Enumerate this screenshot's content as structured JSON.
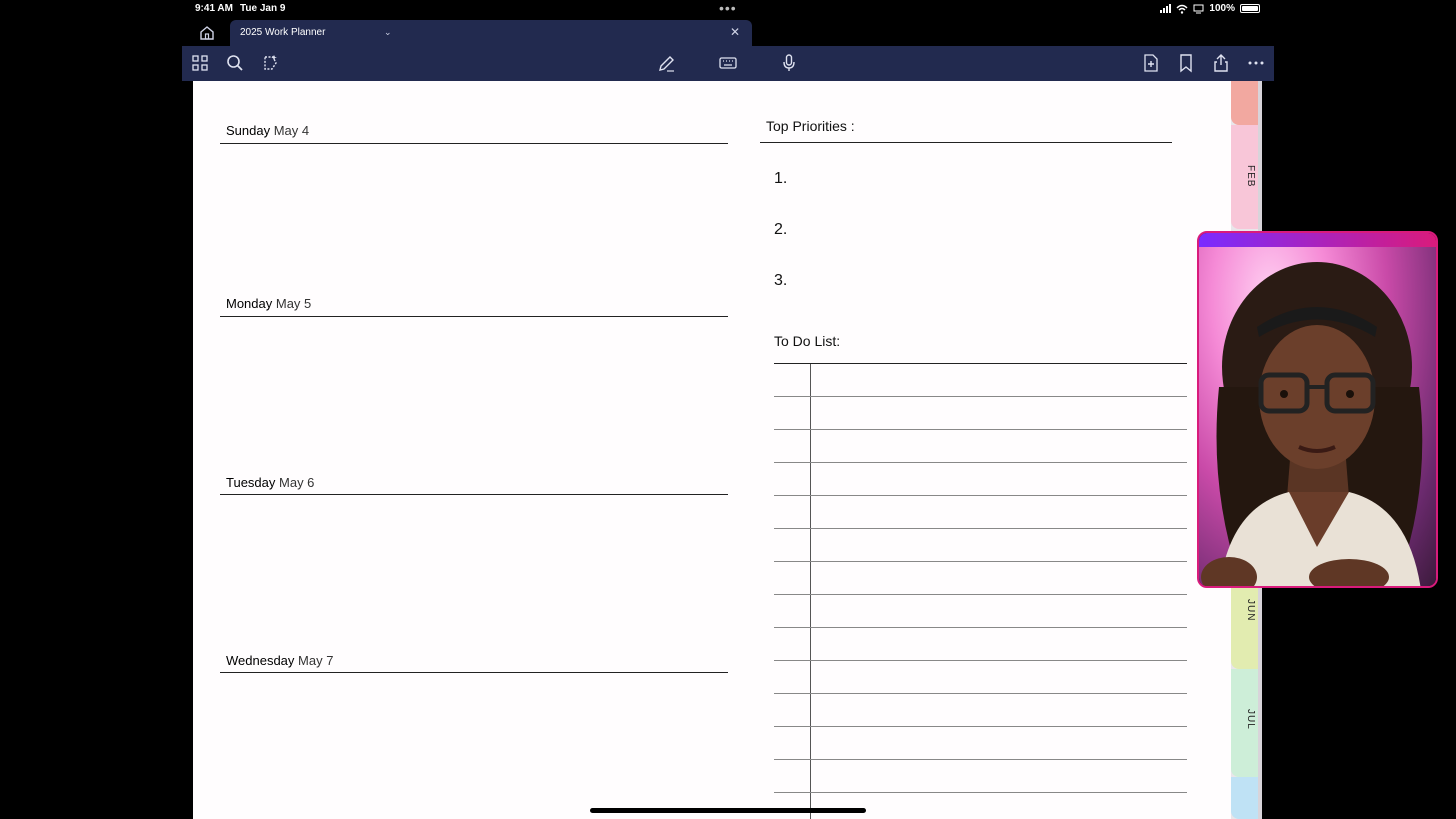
{
  "status_bar": {
    "time": "9:41 AM",
    "date": "Tue Jan 9",
    "battery": "100%"
  },
  "tab": {
    "title": "2025 Work Planner"
  },
  "planner": {
    "days": [
      {
        "weekday": "Sunday",
        "date": "May 4"
      },
      {
        "weekday": "Monday",
        "date": "May 5"
      },
      {
        "weekday": "Tuesday",
        "date": "May 6"
      },
      {
        "weekday": "Wednesday",
        "date": "May 7"
      }
    ],
    "priorities": {
      "title": "Top Priorities :",
      "items": [
        "1.",
        "2.",
        "3."
      ]
    },
    "todo": {
      "title": "To Do List:"
    }
  },
  "month_tabs": [
    {
      "label": "",
      "color": "#f2a8a0"
    },
    {
      "label": "FEB",
      "color": "#f8c6d8"
    },
    {
      "label": "JUN",
      "color": "#e2ecb0"
    },
    {
      "label": "JUL",
      "color": "#cdeed8"
    },
    {
      "label": "",
      "color": "#bfe2f5"
    }
  ],
  "colors": {
    "toolbar_bg": "#222a4f",
    "webcam_border": "#d91b7c"
  },
  "icons": [
    "home-icon",
    "chevron-down-icon",
    "close-icon",
    "grid-icon",
    "search-icon",
    "lasso-icon",
    "pen-icon",
    "keyboard-icon",
    "microphone-icon",
    "add-page-icon",
    "bookmark-icon",
    "share-icon",
    "more-icon"
  ]
}
